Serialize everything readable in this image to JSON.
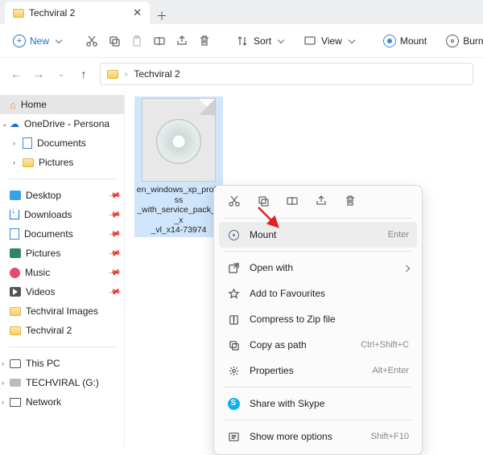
{
  "tab": {
    "title": "Techviral 2"
  },
  "toolbar": {
    "new": "New",
    "sort": "Sort",
    "view": "View",
    "mount": "Mount",
    "burn": "Burn"
  },
  "breadcrumb": {
    "current": "Techviral 2"
  },
  "sidebar": {
    "home": "Home",
    "onedrive": "OneDrive - Persona",
    "od_documents": "Documents",
    "od_pictures": "Pictures",
    "desktop": "Desktop",
    "downloads": "Downloads",
    "documents": "Documents",
    "pictures": "Pictures",
    "music": "Music",
    "videos": "Videos",
    "techviral_images": "Techviral Images",
    "techviral2": "Techviral 2",
    "thispc": "This PC",
    "drive": "TECHVIRAL (G:)",
    "network": "Network"
  },
  "file": {
    "name_l1": "en_windows_xp_profess",
    "name_l2": "_with_service_pack_3_x",
    "name_l3": "_vl_x14-73974"
  },
  "ctx": {
    "mount": "Mount",
    "mount_shortcut": "Enter",
    "open_with": "Open with",
    "favourites": "Add to Favourites",
    "compress": "Compress to Zip file",
    "copy_path": "Copy as path",
    "copy_path_shortcut": "Ctrl+Shift+C",
    "properties": "Properties",
    "properties_shortcut": "Alt+Enter",
    "skype": "Share with Skype",
    "more": "Show more options",
    "more_shortcut": "Shift+F10"
  }
}
